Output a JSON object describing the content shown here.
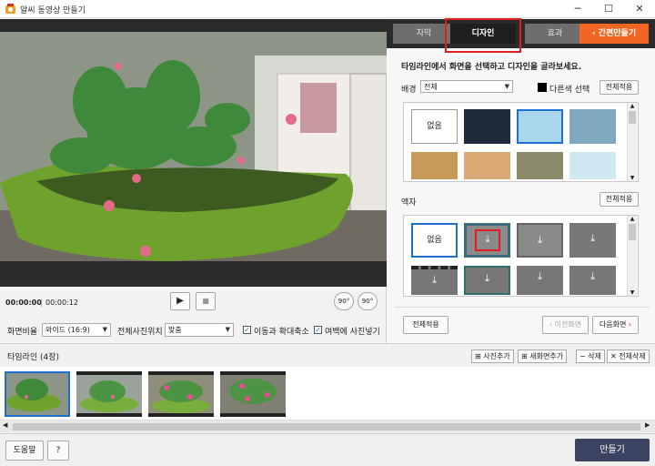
{
  "window": {
    "title": "알씨 동영상 만들기",
    "minimize": "─",
    "maximize": "☐",
    "close": "✕"
  },
  "player": {
    "time_current": "00:00:00",
    "time_total": "00:00:12",
    "play_icon": "▶",
    "stop_icon": "■",
    "rotate_left": "90°",
    "rotate_right": "90°"
  },
  "settings": {
    "ratio_label": "화면비율",
    "ratio_value": "와이드 (16:9)",
    "position_label": "전체사진위치",
    "position_value": "맞춤",
    "move_zoom_label": "이동과 확대축소",
    "margin_label": "여백에 사진넣기"
  },
  "tabs": {
    "subtitle": "자막",
    "design": "디자인",
    "effects": "효과",
    "easy": "간편만들기"
  },
  "design": {
    "instruction": "타임라인에서 화면을 선택하고 디자인을 골라보세요.",
    "background_label": "배경",
    "background_value": "전체",
    "other_color_label": "다른색 선택",
    "apply_all": "전체적용",
    "none_label": "없음",
    "frame_label": "액자",
    "frame_apply_all": "전체적용",
    "frame_none_label": "없음"
  },
  "footer_right": {
    "apply_all": "전체적용",
    "prev": "이전화면",
    "next": "다음화면"
  },
  "timeline": {
    "label": "타임라인 (4장)",
    "add_photo": "사진추가",
    "add_blank": "새화면추가",
    "delete": "삭제",
    "delete_all": "전체삭제"
  },
  "bottom": {
    "help": "도움말",
    "question": "?",
    "make": "만들기"
  },
  "colors": {
    "accent_orange": "#f26522",
    "selection_blue": "#1f6fd1",
    "highlight_red": "#e02020"
  }
}
